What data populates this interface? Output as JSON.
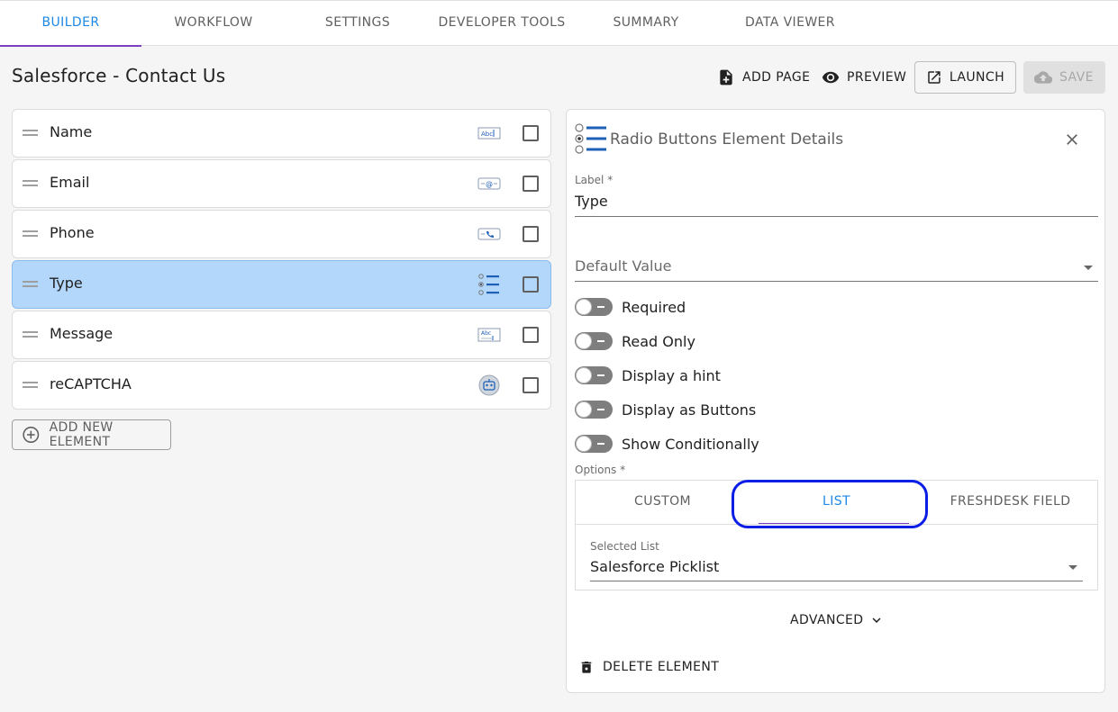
{
  "tabs": [
    {
      "label": "BUILDER",
      "active": true
    },
    {
      "label": "WORKFLOW",
      "active": false
    },
    {
      "label": "SETTINGS",
      "active": false
    },
    {
      "label": "DEVELOPER TOOLS",
      "active": false
    },
    {
      "label": "SUMMARY",
      "active": false
    },
    {
      "label": "DATA VIEWER",
      "active": false
    }
  ],
  "header": {
    "title": "Salesforce - Contact Us",
    "add_page": "ADD PAGE",
    "preview": "PREVIEW",
    "launch": "LAUNCH",
    "save": "SAVE"
  },
  "elements": [
    {
      "label": "Name",
      "icon": "text-field-icon",
      "selected": false
    },
    {
      "label": "Email",
      "icon": "email-field-icon",
      "selected": false
    },
    {
      "label": "Phone",
      "icon": "phone-field-icon",
      "selected": false
    },
    {
      "label": "Type",
      "icon": "radio-list-icon",
      "selected": true
    },
    {
      "label": "Message",
      "icon": "textarea-icon",
      "selected": false
    },
    {
      "label": "reCAPTCHA",
      "icon": "robot-icon",
      "selected": false
    }
  ],
  "add_element": "ADD NEW ELEMENT",
  "details": {
    "title": "Radio Buttons Element Details",
    "label_caption": "Label *",
    "label_value": "Type",
    "default_value_placeholder": "Default Value",
    "toggles": [
      {
        "label": "Required",
        "on": false
      },
      {
        "label": "Read Only",
        "on": false
      },
      {
        "label": "Display a hint",
        "on": false
      },
      {
        "label": "Display as Buttons",
        "on": false
      },
      {
        "label": "Show Conditionally",
        "on": false
      }
    ],
    "options_caption": "Options *",
    "option_tabs": [
      {
        "label": "CUSTOM",
        "active": false
      },
      {
        "label": "LIST",
        "active": true
      },
      {
        "label": "FRESHDESK FIELD",
        "active": false
      }
    ],
    "selected_list_caption": "Selected List",
    "selected_list_value": "Salesforce Picklist",
    "advanced": "ADVANCED",
    "delete": "DELETE ELEMENT"
  },
  "colors": {
    "accent": "#1e88e5",
    "tab_underline": "#7b3fbf",
    "selected_row": "#b3d7fb",
    "highlight_ring": "#0a1ee6"
  }
}
